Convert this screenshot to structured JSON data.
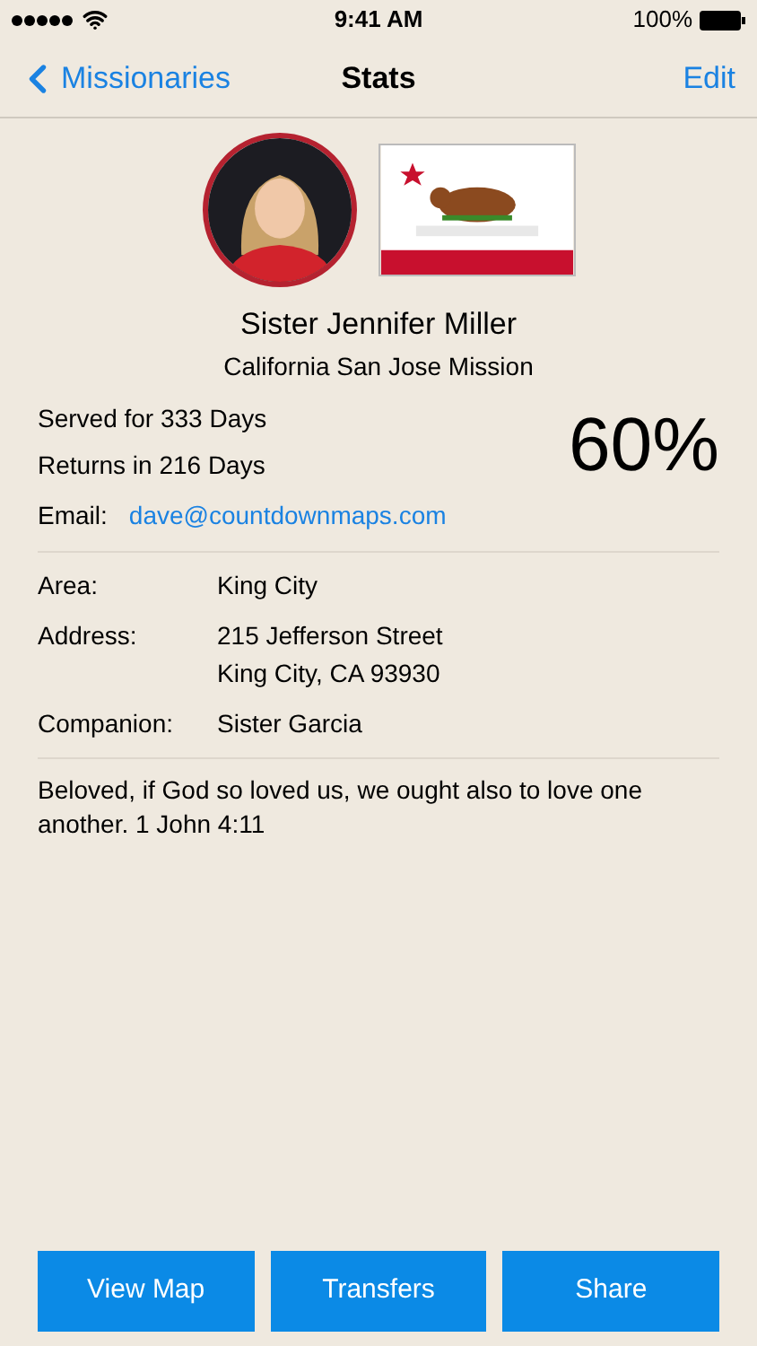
{
  "status_bar": {
    "time": "9:41 AM",
    "battery": "100%"
  },
  "nav": {
    "back": "Missionaries",
    "title": "Stats",
    "action": "Edit"
  },
  "profile": {
    "name": "Sister Jennifer Miller",
    "mission": "California San Jose Mission"
  },
  "stats": {
    "served": "Served for 333 Days",
    "returns": "Returns in 216 Days",
    "percent": "60%",
    "email_label": "Email:",
    "email": "dave@countdownmaps.com"
  },
  "details": [
    {
      "label": "Area:",
      "lines": [
        "King City"
      ]
    },
    {
      "label": "Address:",
      "lines": [
        "215 Jefferson Street",
        "King City, CA 93930"
      ]
    },
    {
      "label": "Companion:",
      "lines": [
        "Sister Garcia"
      ]
    }
  ],
  "quote": "Beloved, if God so loved us, we ought also to love one another. 1 John 4:11",
  "buttons": [
    "View Map",
    "Transfers",
    "Share"
  ]
}
